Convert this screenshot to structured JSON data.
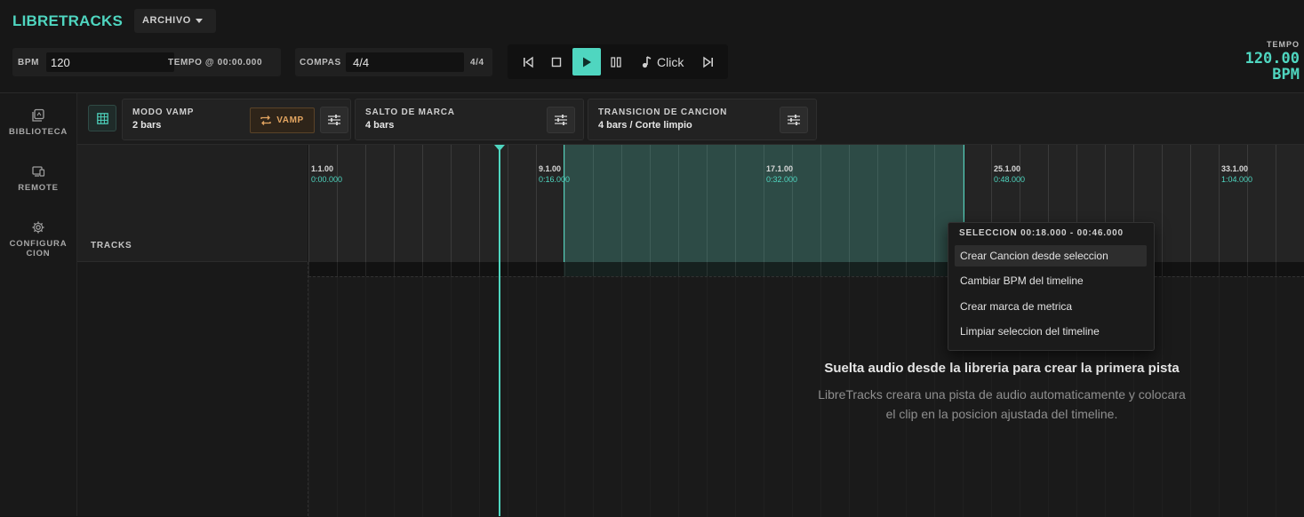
{
  "app": {
    "title": "LIBRETRACKS",
    "menu_label": "ARCHIVO"
  },
  "transport_bar": {
    "bpm_label": "BPM",
    "bpm_value": "120",
    "tempo_at_label": "TEMPO @ 00:00.000",
    "compas_label": "COMPAS",
    "compas_value": "4/4",
    "compas_display": "4/4",
    "click_label": "Click"
  },
  "tempo_readout": {
    "label": "TEMPO",
    "value": "120.00",
    "unit": "BPM"
  },
  "sidebar": {
    "items": [
      {
        "label": "BIBLIOTECA",
        "icon": "library-icon"
      },
      {
        "label": "REMOTE",
        "icon": "devices-icon"
      },
      {
        "label": "CONFIGURA\nCION",
        "icon": "gear-icon"
      }
    ]
  },
  "toolbar": {
    "vamp": {
      "title": "MODO VAMP",
      "value": "2 bars",
      "button": "VAMP"
    },
    "salto": {
      "title": "SALTO DE MARCA",
      "value": "4 bars"
    },
    "transicion": {
      "title": "TRANSICION DE CANCION",
      "value": "4 bars / Corte limpio"
    }
  },
  "timeline": {
    "tracks_label": "TRACKS",
    "markers": [
      {
        "bar": "1.1.00",
        "time": "0:00.000"
      },
      {
        "bar": "9.1.00",
        "time": "0:16.000"
      },
      {
        "bar": "17.1.00",
        "time": "0:32.000"
      },
      {
        "bar": "25.1.00",
        "time": "0:48.000"
      },
      {
        "bar": "33.1.00",
        "time": "1:04.000"
      }
    ],
    "empty_title": "Suelta audio desde la libreria para crear la primera pista",
    "empty_subtitle_1": "LibreTracks creara una pista de audio automaticamente y colocara",
    "empty_subtitle_2": "el clip en la posicion ajustada del timeline."
  },
  "context_menu": {
    "title": "SELECCION 00:18.000 - 00:46.000",
    "items": [
      "Crear Cancion desde seleccion",
      "Cambiar BPM del timeline",
      "Crear marca de metrica",
      "Limpiar seleccion del timeline"
    ]
  },
  "colors": {
    "accent": "#4fd6c0",
    "vamp": "#e3a561"
  }
}
